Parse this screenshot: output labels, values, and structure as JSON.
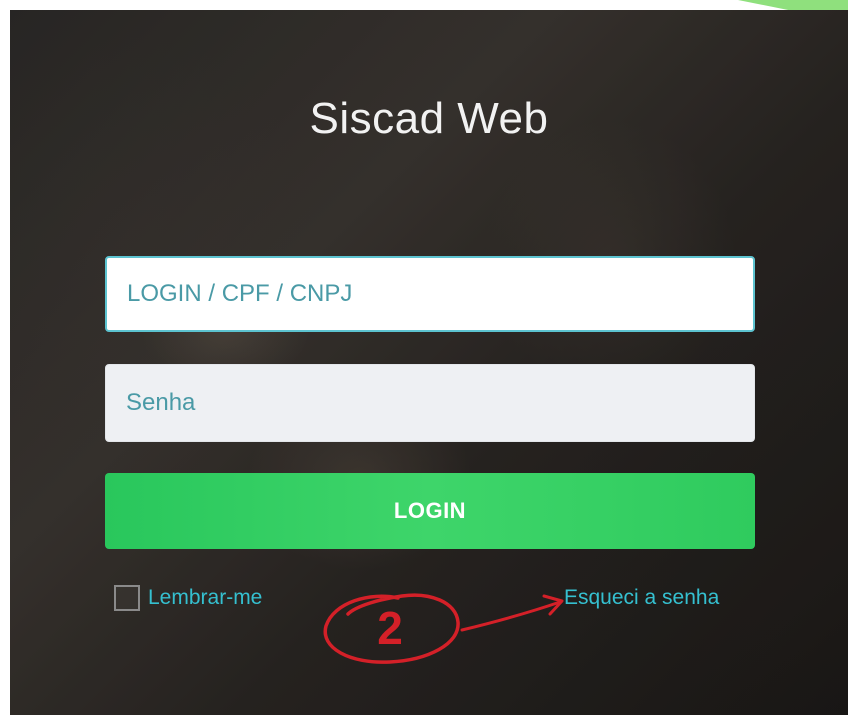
{
  "app": {
    "title": "Siscad Web"
  },
  "form": {
    "login_placeholder": "LOGIN / CPF / CNPJ",
    "password_placeholder": "Senha",
    "login_button_label": "LOGIN",
    "remember_label": "Lembrar-me",
    "remember_checked": false,
    "forgot_label": "Esqueci a senha"
  },
  "annotation": {
    "step_number": "2",
    "arrow_target": "forgot-password-link",
    "color": "#d42028"
  },
  "colors": {
    "accent_teal": "#35c0d0",
    "button_green": "#33cf63",
    "corner_green": "#8fe07d"
  }
}
